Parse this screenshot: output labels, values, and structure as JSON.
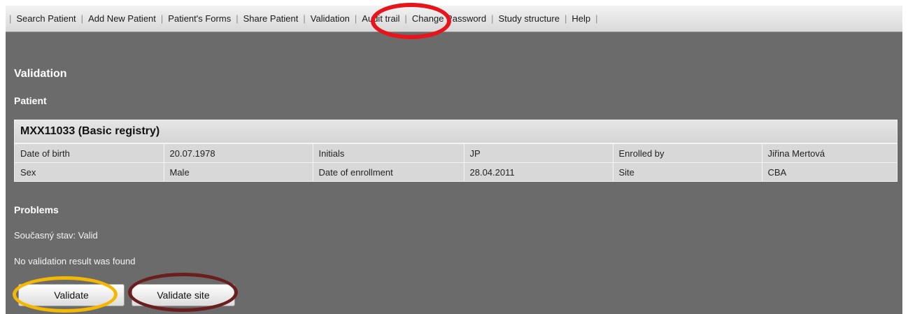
{
  "menu": {
    "items": [
      {
        "label": "Search Patient"
      },
      {
        "label": "Add New Patient"
      },
      {
        "label": "Patient's Forms"
      },
      {
        "label": "Share Patient"
      },
      {
        "label": "Validation"
      },
      {
        "label": "Audit trail"
      },
      {
        "label": "Change Password"
      },
      {
        "label": "Study structure"
      },
      {
        "label": "Help"
      }
    ],
    "separator": "|"
  },
  "page": {
    "title": "Validation",
    "patient_heading": "Patient",
    "problems_heading": "Problems",
    "status_text": "Současný stav: Valid",
    "result_text": "No validation result was found"
  },
  "patient": {
    "title": "MXX11033 (Basic registry)",
    "rows": [
      [
        "Date of birth",
        "20.07.1978",
        "Initials",
        "JP",
        "Enrolled by",
        "Jiřina Mertová"
      ],
      [
        "Sex",
        "Male",
        "Date of enrollment",
        "28.04.2011",
        "Site",
        "CBA"
      ]
    ]
  },
  "buttons": {
    "validate": "Validate",
    "validate_site": "Validate site"
  },
  "annotations": {
    "validation_ring_color": "#e8141c",
    "validate_ring_color": "#f5b800",
    "validate_site_ring_color": "#6b1e1e"
  }
}
